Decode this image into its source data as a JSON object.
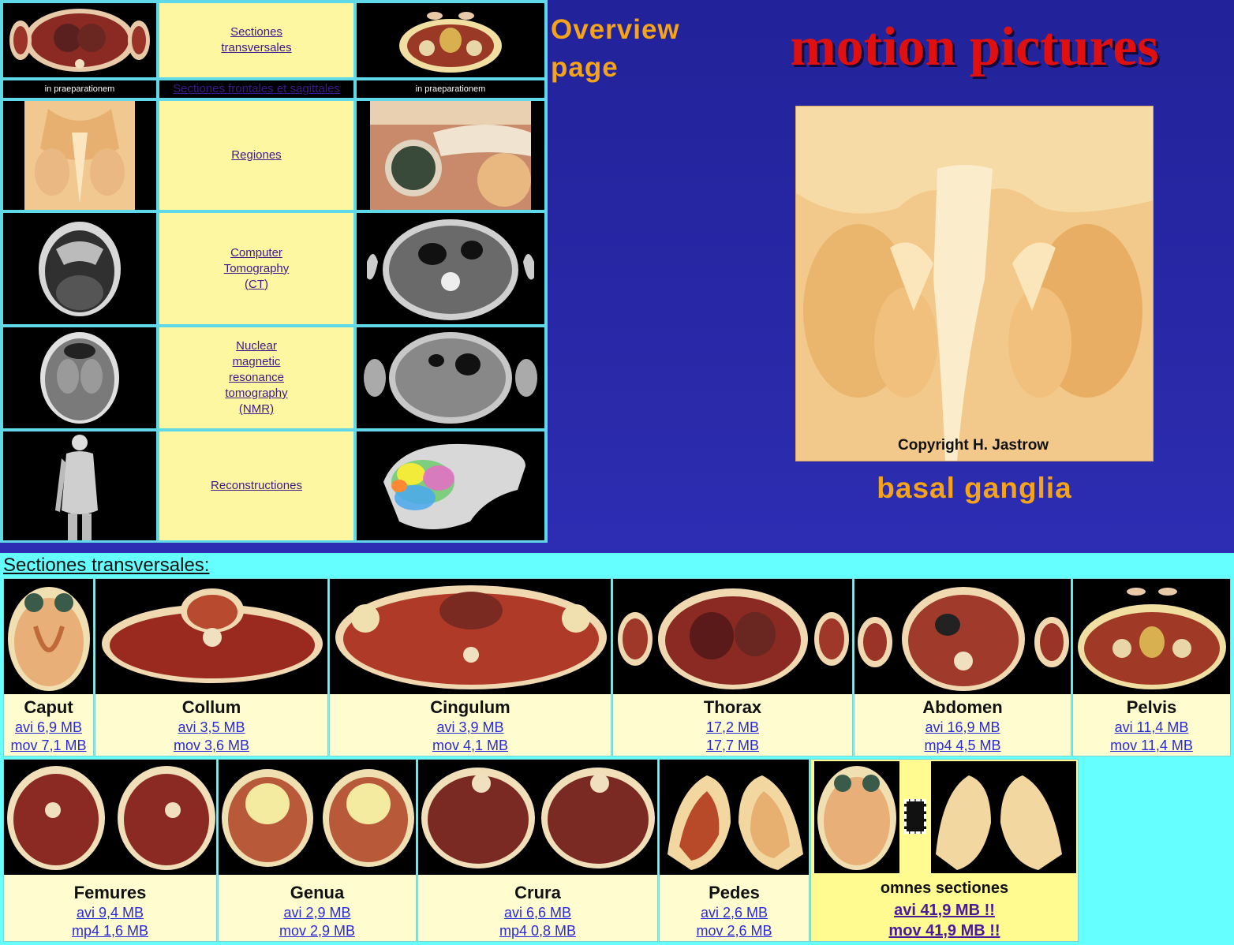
{
  "nav": {
    "transversal_link": "Sectiones transversales",
    "praeparation_left": "in praeparationem",
    "frontal_sagittal_link": "Sectiones frontales et sagittales",
    "praeparation_right": "in praeparationem",
    "regiones_link": "Regiones",
    "ct_link": "Computer Tomography (CT)",
    "nmr_link": "Nuclear magnetic resonance tomography (NMR)",
    "recon_link": "Reconstructiones"
  },
  "hero": {
    "overview_link": "Overview page",
    "title": "motion pictures",
    "image_copyright": "Copyright H. Jastrow",
    "caption": "basal ganglia"
  },
  "lower": {
    "title": "Sectiones transversales:",
    "row1": [
      {
        "name": "Caput",
        "link1": "avi 6,9 MB",
        "link2": "mov 7,1 MB"
      },
      {
        "name": "Collum",
        "link1": "avi 3,5 MB",
        "link2": "mov 3,6 MB"
      },
      {
        "name": "Cingulum",
        "link1": "avi 3,9 MB",
        "link2": "mov 4,1 MB"
      },
      {
        "name": "Thorax",
        "link1": "17,2 MB",
        "link2": "17,7 MB"
      },
      {
        "name": "Abdomen",
        "link1": "avi 16,9 MB",
        "link2": "mp4 4,5 MB"
      },
      {
        "name": "Pelvis",
        "link1": "avi 11,4 MB",
        "link2": "mov 11,4 MB"
      }
    ],
    "row2": [
      {
        "name": "Femures",
        "link1": "avi 9,4 MB",
        "link2": "mp4 1,6 MB"
      },
      {
        "name": "Genua",
        "link1": "avi 2,9 MB",
        "link2": "mov 2,9 MB"
      },
      {
        "name": "Crura",
        "link1": "avi 6,6 MB",
        "link2": "mp4 0,8 MB"
      },
      {
        "name": "Pedes",
        "link1": "avi 2,6 MB",
        "link2": "mov 2,6 MB"
      }
    ],
    "omnes": {
      "name": "omnes sectiones",
      "link1": "avi 41,9 MB !!",
      "link2": "mov 41,9 MB !!"
    }
  },
  "colors": {
    "accent_orange": "#f5a31a",
    "title_red": "#e01010",
    "cyan": "#66ffff",
    "cell_yellow": "#fdf7a2",
    "page_blue": "#2a2aab"
  }
}
